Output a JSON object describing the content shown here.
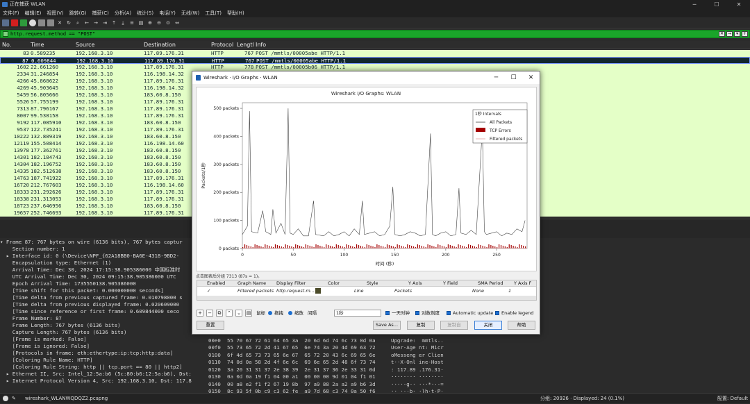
{
  "window": {
    "title": "正在捕获 WLAN"
  },
  "menu": [
    "文件(F)",
    "编辑(E)",
    "视图(V)",
    "跳转(G)",
    "捕获(C)",
    "分析(A)",
    "统计(S)",
    "电话(Y)",
    "无线(W)",
    "工具(T)",
    "帮助(H)"
  ],
  "filter": {
    "value": "http.request.method == \"POST\""
  },
  "columns": {
    "no": "No.",
    "time": "Time",
    "source": "Source",
    "destination": "Destination",
    "protocol": "Protocol",
    "length": "Lengtl",
    "info": "Info"
  },
  "packets": [
    {
      "no": "83",
      "time": "0.589235",
      "src": "192.168.3.10",
      "dst": "117.89.176.31",
      "proto": "HTTP",
      "len": "767",
      "info": "POST /mmtls/00005abe HTTP/1.1"
    },
    {
      "no": "87",
      "time": "0.609844",
      "src": "192.168.3.10",
      "dst": "117.89.176.31",
      "proto": "HTTP",
      "len": "767",
      "info": "POST /mmtls/00005abe HTTP/1.1"
    },
    {
      "no": "1602",
      "time": "22.661260",
      "src": "192.168.3.10",
      "dst": "117.89.176.31",
      "proto": "HTTP",
      "len": "778",
      "info": "POST /mmtls/00005b06 HTTP/1.1"
    },
    {
      "no": "2334",
      "time": "31.246854",
      "src": "192.168.3.10",
      "dst": "116.198.14.32",
      "proto": "",
      "len": "",
      "info": ""
    },
    {
      "no": "4266",
      "time": "45.868622",
      "src": "192.168.3.10",
      "dst": "117.89.176.31",
      "proto": "",
      "len": "",
      "info": ""
    },
    {
      "no": "4269",
      "time": "45.903645",
      "src": "192.168.3.10",
      "dst": "116.198.14.32",
      "proto": "",
      "len": "",
      "info": ""
    },
    {
      "no": "5459",
      "time": "56.805666",
      "src": "192.168.3.10",
      "dst": "183.60.8.150",
      "proto": "",
      "len": "",
      "info": ""
    },
    {
      "no": "5526",
      "time": "57.755199",
      "src": "192.168.3.10",
      "dst": "117.89.176.31",
      "proto": "",
      "len": "",
      "info": ""
    },
    {
      "no": "7313",
      "time": "87.796167",
      "src": "192.168.3.10",
      "dst": "117.89.176.31",
      "proto": "",
      "len": "",
      "info": ""
    },
    {
      "no": "8007",
      "time": "99.538158",
      "src": "192.168.3.10",
      "dst": "117.89.176.31",
      "proto": "",
      "len": "",
      "info": ""
    },
    {
      "no": "9192",
      "time": "117.085910",
      "src": "192.168.3.10",
      "dst": "183.60.8.150",
      "proto": "",
      "len": "",
      "info": ""
    },
    {
      "no": "9537",
      "time": "122.735241",
      "src": "192.168.3.10",
      "dst": "117.89.176.31",
      "proto": "",
      "len": "",
      "info": ""
    },
    {
      "no": "10222",
      "time": "132.889319",
      "src": "192.168.3.10",
      "dst": "183.60.8.150",
      "proto": "",
      "len": "",
      "info": ""
    },
    {
      "no": "12119",
      "time": "155.508414",
      "src": "192.168.3.10",
      "dst": "116.198.14.60",
      "proto": "",
      "len": "",
      "info": ""
    },
    {
      "no": "13978",
      "time": "177.362761",
      "src": "192.168.3.10",
      "dst": "183.60.8.150",
      "proto": "",
      "len": "",
      "info": ""
    },
    {
      "no": "14301",
      "time": "182.184743",
      "src": "192.168.3.10",
      "dst": "183.60.8.150",
      "proto": "",
      "len": "",
      "info": ""
    },
    {
      "no": "14304",
      "time": "182.196752",
      "src": "192.168.3.10",
      "dst": "183.60.8.150",
      "proto": "",
      "len": "",
      "info": ""
    },
    {
      "no": "14335",
      "time": "182.512638",
      "src": "192.168.3.10",
      "dst": "183.60.8.150",
      "proto": "",
      "len": "",
      "info": ""
    },
    {
      "no": "14763",
      "time": "187.741922",
      "src": "192.168.3.10",
      "dst": "117.89.176.31",
      "proto": "",
      "len": "",
      "info": ""
    },
    {
      "no": "16720",
      "time": "212.767603",
      "src": "192.168.3.10",
      "dst": "116.198.14.60",
      "proto": "",
      "len": "",
      "info": ""
    },
    {
      "no": "18333",
      "time": "231.292626",
      "src": "192.168.3.10",
      "dst": "117.89.176.31",
      "proto": "",
      "len": "",
      "info": ""
    },
    {
      "no": "18338",
      "time": "231.313053",
      "src": "192.168.3.10",
      "dst": "117.89.176.31",
      "proto": "",
      "len": "",
      "info": ""
    },
    {
      "no": "18723",
      "time": "237.646956",
      "src": "192.168.3.10",
      "dst": "183.60.8.150",
      "proto": "",
      "len": "",
      "info": ""
    },
    {
      "no": "19657",
      "time": "252.746693",
      "src": "192.168.3.10",
      "dst": "117.89.176.31",
      "proto": "",
      "len": "",
      "info": ""
    }
  ],
  "details": [
    "▾ Frame 87: 767 bytes on wire (6136 bits), 767 bytes captur",
    "    Section number: 1",
    "  ▸ Interface id: 0 (\\Device\\NPF_{62A18BB0-BA6E-4318-9BD2-",
    "    Encapsulation type: Ethernet (1)",
    "    Arrival Time: Dec 30, 2024 17:15:38.905386000 中国标准时",
    "    UTC Arrival Time: Dec 30, 2024 09:15:38.905386000 UTC",
    "    Epoch Arrival Time: 1735550138.905386000",
    "    [Time shift for this packet: 0.000000000 seconds]",
    "    [Time delta from previous captured frame: 0.010798000 s",
    "    [Time delta from previous displayed frame: 0.020609000",
    "    [Time since reference or first frame: 0.609844000 seco",
    "    Frame Number: 87",
    "    Frame Length: 767 bytes (6136 bits)",
    "    Capture Length: 767 bytes (6136 bits)",
    "    [Frame is marked: False]",
    "    [Frame is ignored: False]",
    "    [Protocols in frame: eth:ethertype:ip:tcp:http:data]",
    "    [Coloring Rule Name: HTTP]",
    "    [Coloring Rule String: http || tcp.port == 80 || http2]",
    "  ▸ Ethernet II, Src: Intel_12:5a:b6 (5c:80:b6:12:5a:b6), Dst:",
    "  ▸ Internet Protocol Version 4, Src: 192.168.3.10, Dst: 117.8"
  ],
  "bytes": [
    {
      "off": "",
      "hex": "20 31 31 37 2e 38 39 2e  31 37 36 2e 33 31 0d 0a",
      "ascii": " 117.89. 176.31.."
    },
    {
      "off": "00e0",
      "hex": "55 70 67 72 61 64 65 3a  20 6d 6d 74 6c 73 0d 0a",
      "ascii": "Upgrade:  mmtls.."
    },
    {
      "off": "00f0",
      "hex": "55 73 65 72 2d 41 67 65  6e 74 3a 20 4d 69 63 72",
      "ascii": "User-Age nt: Micr"
    },
    {
      "off": "0100",
      "hex": "6f 4d 65 73 73 65 6e 67  65 72 20 43 6c 69 65 6e",
      "ascii": "oMesseng er Clien"
    },
    {
      "off": "0110",
      "hex": "74 0d 0a 58 2d 4f 6e 6c  69 6e 65 2d 48 6f 73 74",
      "ascii": "t··X-Onl ine-Host"
    },
    {
      "off": "0120",
      "hex": "3a 20 31 31 37 2e 38 39  2e 31 37 36 2e 33 31 0d",
      "ascii": ": 117.89 .176.31·"
    },
    {
      "off": "0130",
      "hex": "0a 0d 0a 19 f1 04 00 a1  00 00 00 9d 01 04 f1 01",
      "ascii": "········ ········"
    },
    {
      "off": "0140",
      "hex": "00 a8 e2 f1 f2 67 19 8b  97 a9 88 2a a2 a9 b6 3d",
      "ascii": "·····g·· ···*···="
    },
    {
      "off": "0150",
      "hex": "8c 93 5f 0b c9 c3 62 fe  a9 7d 68 c3 74 0a 50 f6",
      "ascii": "··_···b· ·}h·t·P·"
    }
  ],
  "status": {
    "file": "wireshark_WLANWQDQZ2.pcapng",
    "counts": "分组: 20926 · Displayed: 24 (0.1%)",
    "profile": "配置: Default"
  },
  "dialog": {
    "title": "Wireshark · I/O Graphs · WLAN",
    "caption": "点击图表后分组 7313 (87s = 1)。",
    "table_headers": [
      "Enabled",
      "Graph Name",
      "Display Filter",
      "Color",
      "Style",
      "Y Axis",
      "Y Field",
      "SMA Period",
      "Y Axis F"
    ],
    "row": {
      "enabled": "✓",
      "name": "Filtered packets",
      "filter": "http.request.m...",
      "style": "Line",
      "yaxis": "Packets",
      "yfield": "",
      "sma": "None",
      "yfactor": "1"
    },
    "controls": {
      "mouse": "鼠标",
      "drag": "拖拽",
      "zoom": "缩放",
      "interval_label": "间隔",
      "interval": "1秒",
      "time_of_day": "一天时钟",
      "log_scale": "对数刻度",
      "auto_update": "Automatic update",
      "legend": "Enable legend"
    },
    "buttons": {
      "reset": "重置",
      "saveas": "Save As...",
      "copy": "复制",
      "copy_from": "复制自",
      "close": "关闭",
      "help": "帮助"
    }
  },
  "chart_data": {
    "type": "line",
    "title": "Wireshark I/O Graphs: WLAN",
    "xlabel": "时间 (秒)",
    "ylabel": "Packets/1秒",
    "xlim": [
      0,
      280
    ],
    "ylim": [
      0,
      520
    ],
    "x_ticks": [
      0,
      50,
      100,
      150,
      200,
      250
    ],
    "y_ticks": [
      "0 packets",
      "100 packets",
      "200 packets",
      "300 packets",
      "400 packets",
      "500 packets"
    ],
    "legend": {
      "placement": "top-right",
      "title": "1秒 Intervals",
      "entries": [
        "All Packets",
        "TCP Errors",
        "Filtered packets"
      ]
    },
    "series": [
      {
        "name": "All Packets",
        "color": "#444444",
        "points": [
          [
            0,
            50
          ],
          [
            5,
            80
          ],
          [
            7,
            490
          ],
          [
            9,
            60
          ],
          [
            15,
            55
          ],
          [
            20,
            135
          ],
          [
            23,
            60
          ],
          [
            28,
            50
          ],
          [
            30,
            140
          ],
          [
            33,
            55
          ],
          [
            38,
            90
          ],
          [
            42,
            50
          ],
          [
            45,
            500
          ],
          [
            47,
            55
          ],
          [
            50,
            50
          ],
          [
            55,
            70
          ],
          [
            60,
            45
          ],
          [
            65,
            45
          ],
          [
            70,
            170
          ],
          [
            72,
            50
          ],
          [
            80,
            45
          ],
          [
            85,
            60
          ],
          [
            90,
            45
          ],
          [
            95,
            50
          ],
          [
            100,
            60
          ],
          [
            105,
            45
          ],
          [
            110,
            70
          ],
          [
            115,
            50
          ],
          [
            118,
            170
          ],
          [
            120,
            50
          ],
          [
            125,
            55
          ],
          [
            130,
            60
          ],
          [
            135,
            45
          ],
          [
            140,
            50
          ],
          [
            145,
            80
          ],
          [
            148,
            220
          ],
          [
            150,
            50
          ],
          [
            155,
            45
          ],
          [
            160,
            50
          ],
          [
            165,
            60
          ],
          [
            170,
            55
          ],
          [
            175,
            45
          ],
          [
            180,
            50
          ],
          [
            185,
            410
          ],
          [
            187,
            50
          ],
          [
            190,
            45
          ],
          [
            195,
            55
          ],
          [
            200,
            60
          ],
          [
            205,
            45
          ],
          [
            210,
            50
          ],
          [
            213,
            215
          ],
          [
            215,
            55
          ],
          [
            220,
            50
          ],
          [
            225,
            65
          ],
          [
            230,
            50
          ],
          [
            236,
            430
          ],
          [
            238,
            60
          ],
          [
            240,
            50
          ],
          [
            245,
            55
          ],
          [
            250,
            60
          ],
          [
            255,
            45
          ],
          [
            260,
            55
          ],
          [
            265,
            50
          ],
          [
            270,
            70
          ],
          [
            275,
            60
          ],
          [
            278,
            100
          ]
        ]
      },
      {
        "name": "TCP Errors",
        "color": "#a40000",
        "values_note": ""
      },
      {
        "name": "Filtered packets",
        "color": "#e0a0a0",
        "points": [
          [
            0,
            1
          ],
          [
            280,
            1
          ]
        ]
      }
    ]
  }
}
